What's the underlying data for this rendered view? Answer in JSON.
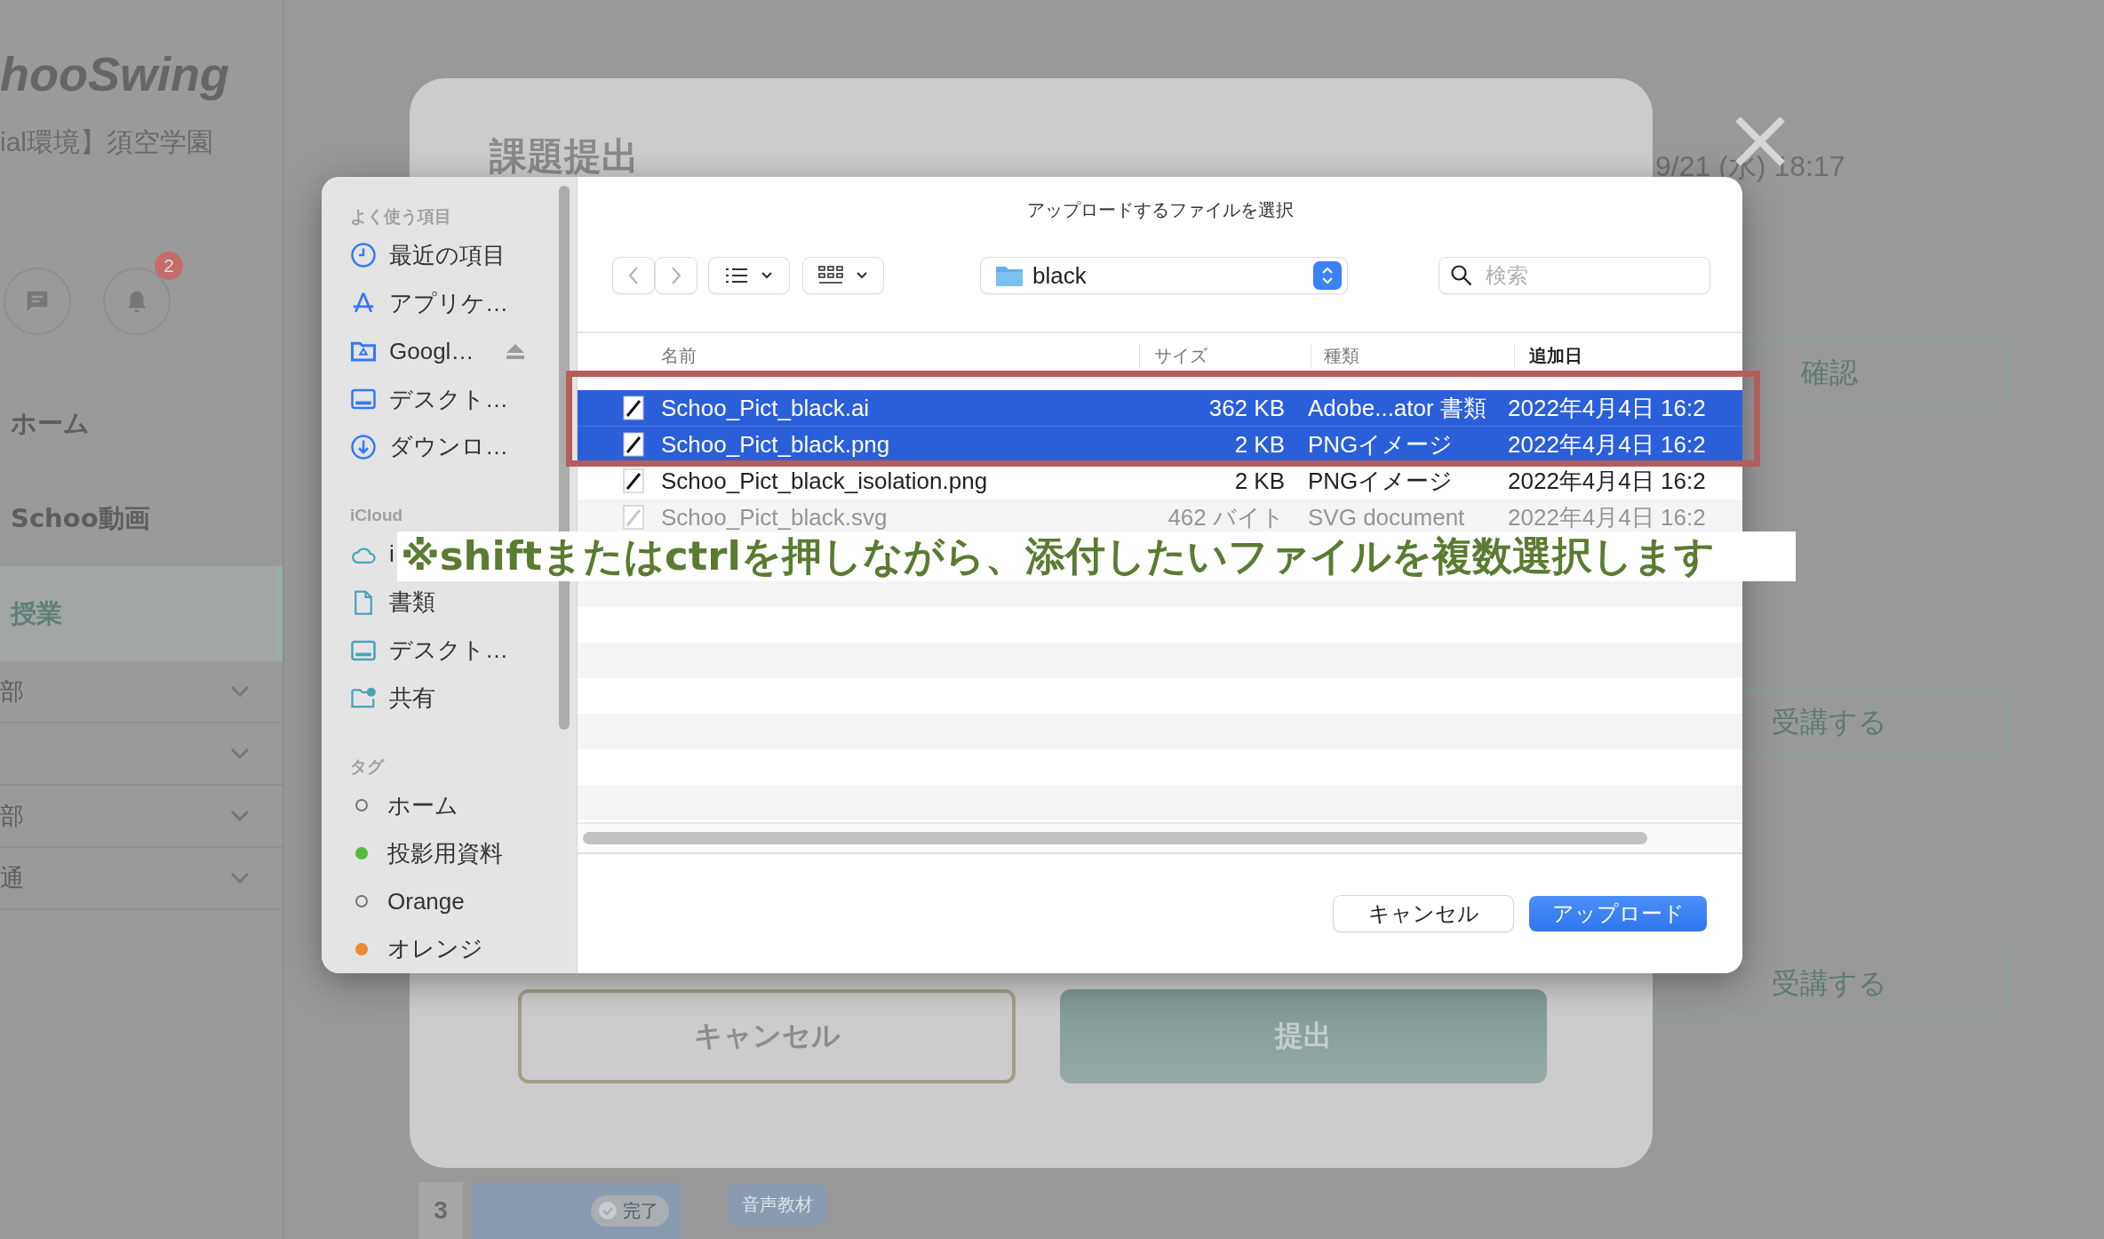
{
  "app": {
    "logo": "hooSwing",
    "tenant": "ial環境】須空学園",
    "notification_count": "2",
    "nav": [
      {
        "label": "ホーム",
        "selected": false
      },
      {
        "label": "Schoo動画",
        "selected": false
      },
      {
        "label": "授業",
        "selected": true
      }
    ],
    "sections": [
      {
        "label": "部",
        "expanded": false
      },
      {
        "expanded": false
      },
      {
        "label": "部",
        "expanded": false
      },
      {
        "label": "通",
        "expanded": false
      }
    ]
  },
  "page": {
    "date": "9/21 (水) 18:17",
    "actions": [
      "確認",
      "受講する",
      "受講する"
    ],
    "lesson": {
      "number": "3",
      "status": "完了",
      "tag": "音声教材"
    }
  },
  "modal": {
    "title": "課題提出",
    "buttons": [
      {
        "label": "キャンセル",
        "kind": "secondary"
      },
      {
        "label": "提出",
        "kind": "primary"
      }
    ]
  },
  "file_dialog": {
    "title": "アップロードするファイルを選択",
    "folder": "black",
    "search": {
      "placeholder": "検索"
    },
    "sidebar": [
      {
        "header": "よく使う項目",
        "items": [
          {
            "label": "最近の項目",
            "kind": "clock"
          },
          {
            "label": "アプリケ…",
            "kind": "apps"
          },
          {
            "label": "Googl…",
            "kind": "drive",
            "ejectable": true
          },
          {
            "label": "デスクト…",
            "kind": "desktop"
          },
          {
            "label": "ダウンロ…",
            "kind": "download"
          }
        ]
      },
      {
        "header": "iCloud",
        "items": [
          {
            "label": "i",
            "kind": "cloud"
          },
          {
            "label": "書類",
            "kind": "doc"
          },
          {
            "label": "デスクト…",
            "kind": "desktop"
          },
          {
            "label": "共有",
            "kind": "shared"
          }
        ]
      },
      {
        "header": "タグ",
        "tags": [
          {
            "label": "ホーム"
          },
          {
            "label": "投影用資料",
            "color": "#55bb3a"
          },
          {
            "label": "Orange"
          },
          {
            "label": "オレンジ",
            "color": "#ee8833"
          }
        ]
      }
    ],
    "columns": [
      "名前",
      "サイズ",
      "種類",
      "追加日"
    ],
    "rows": [
      {
        "name": "Schoo_Pict_black.ai",
        "size": "362 KB",
        "type": "Adobe...ator 書類",
        "added": "2022年4月4日 16:2",
        "selected": true,
        "disabled": false
      },
      {
        "name": "Schoo_Pict_black.png",
        "size": "2 KB",
        "type": "PNGイメージ",
        "added": "2022年4月4日 16:2",
        "selected": true,
        "disabled": false
      },
      {
        "name": "Schoo_Pict_black_isolation.png",
        "size": "2 KB",
        "type": "PNGイメージ",
        "added": "2022年4月4日 16:2",
        "selected": false,
        "disabled": false
      },
      {
        "name": "Schoo_Pict_black.svg",
        "size": "462 バイト",
        "type": "SVG document",
        "added": "2022年4月4日 16:2",
        "selected": false,
        "disabled": true
      }
    ],
    "buttons": [
      {
        "label": "キャンセル",
        "kind": "secondary"
      },
      {
        "label": "アップロード",
        "kind": "primary"
      }
    ]
  },
  "hint": "※shiftまたはctrlを押しながら、添付したいファイルを複数選択します"
}
